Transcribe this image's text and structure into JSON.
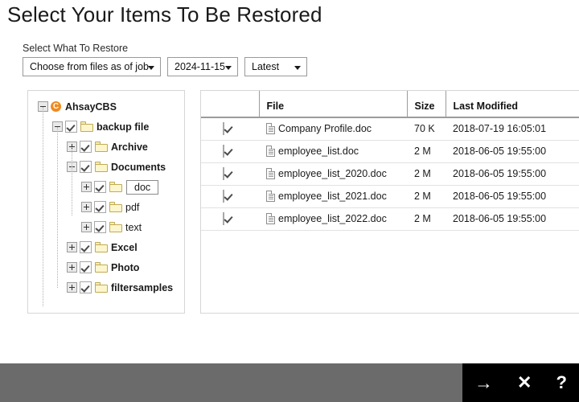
{
  "page": {
    "title": "Select Your Items To Be Restored"
  },
  "controls": {
    "label": "Select What To Restore",
    "source_select": {
      "value": "Choose from files as of job",
      "icon": "chevron-down-icon"
    },
    "date_select": {
      "value": "2024-11-15",
      "icon": "chevron-down-icon"
    },
    "time_select": {
      "value": "Latest",
      "icon": "chevron-down-icon"
    }
  },
  "tree": {
    "root": {
      "label": "AhsayCBS",
      "icon": "ahsaycbs-logo-icon",
      "toggle": "minus",
      "checked": false
    },
    "nodes": [
      {
        "label": "backup file",
        "depth": 1,
        "toggle": "minus",
        "checked": true,
        "icon": "folder-icon",
        "bold": true,
        "selected": false
      },
      {
        "label": "Archive",
        "depth": 2,
        "toggle": "plus",
        "checked": true,
        "icon": "folder-icon",
        "bold": true,
        "selected": false
      },
      {
        "label": "Documents",
        "depth": 2,
        "toggle": "minus",
        "checked": true,
        "icon": "folder-icon",
        "bold": true,
        "selected": false
      },
      {
        "label": "doc",
        "depth": 3,
        "toggle": "plus",
        "checked": true,
        "icon": "folder-icon",
        "bold": false,
        "selected": true
      },
      {
        "label": "pdf",
        "depth": 3,
        "toggle": "plus",
        "checked": true,
        "icon": "folder-icon",
        "bold": false,
        "selected": false
      },
      {
        "label": "text",
        "depth": 3,
        "toggle": "plus",
        "checked": true,
        "icon": "folder-icon",
        "bold": false,
        "selected": false
      },
      {
        "label": "Excel",
        "depth": 2,
        "toggle": "plus",
        "checked": true,
        "icon": "folder-icon",
        "bold": true,
        "selected": false
      },
      {
        "label": "Photo",
        "depth": 2,
        "toggle": "plus",
        "checked": true,
        "icon": "folder-icon",
        "bold": true,
        "selected": false
      },
      {
        "label": "filtersamples",
        "depth": 2,
        "toggle": "plus",
        "checked": true,
        "icon": "folder-icon",
        "bold": true,
        "selected": false
      }
    ]
  },
  "file_table": {
    "columns": [
      "",
      "File",
      "Size",
      "Last Modified"
    ],
    "rows": [
      {
        "checked": true,
        "icon": "document-icon",
        "file": "Company Profile.doc",
        "size": "70 K",
        "modified": "2018-07-19 16:05:01"
      },
      {
        "checked": true,
        "icon": "document-icon",
        "file": "employee_list.doc",
        "size": "2 M",
        "modified": "2018-06-05 19:55:00"
      },
      {
        "checked": true,
        "icon": "document-icon",
        "file": "employee_list_2020.doc",
        "size": "2 M",
        "modified": "2018-06-05 19:55:00"
      },
      {
        "checked": true,
        "icon": "document-icon",
        "file": "employee_list_2021.doc",
        "size": "2 M",
        "modified": "2018-06-05 19:55:00"
      },
      {
        "checked": true,
        "icon": "document-icon",
        "file": "employee_list_2022.doc",
        "size": "2 M",
        "modified": "2018-06-05 19:55:00"
      }
    ]
  },
  "bottom_bar": {
    "background": "#6b6b6b",
    "actions_background": "#000000",
    "actions": [
      {
        "name": "next-button",
        "icon": "arrow-right-icon",
        "glyph": "→"
      },
      {
        "name": "close-button",
        "icon": "close-x-icon",
        "glyph": "✕"
      },
      {
        "name": "help-button",
        "icon": "question-mark-icon",
        "glyph": "?"
      }
    ]
  }
}
